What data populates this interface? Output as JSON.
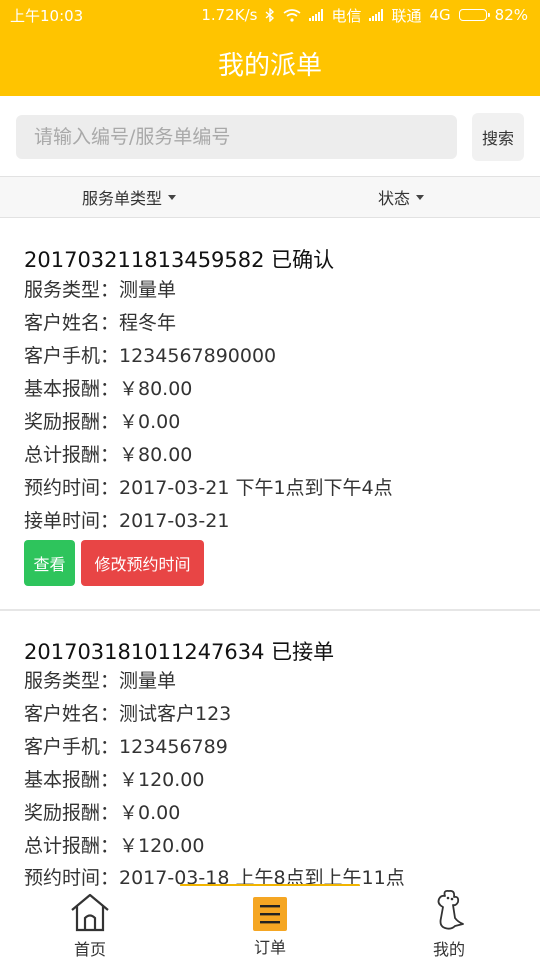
{
  "status_bar": {
    "time": "上午10:03",
    "speed": "1.72K/s",
    "carrier1": "电信",
    "carrier2": "联通",
    "network": "4G",
    "battery": "82%",
    "battery_level": 0.82,
    "icons": [
      "bluetooth-icon",
      "wifi-icon",
      "signal-icon",
      "battery-icon"
    ]
  },
  "header": {
    "title": "我的派单"
  },
  "search": {
    "placeholder": "请输入编号/服务单编号",
    "button_label": "搜索"
  },
  "filters": {
    "type_label": "服务单类型",
    "status_label": "状态"
  },
  "orders": [
    {
      "title": "201703211813459582 已确认",
      "service_type": "服务类型：测量单",
      "customer_name": "客户姓名：程冬年",
      "customer_phone": "客户手机：1234567890000",
      "base_pay": "基本报酬：￥80.00",
      "bonus_pay": "奖励报酬：￥0.00",
      "total_pay": "总计报酬：￥80.00",
      "appointment": "预约时间：2017-03-21 下午1点到下午4点",
      "accept_time": "接单时间：2017-03-21",
      "view_button": "查看",
      "modify_button": "修改预约时间"
    },
    {
      "title": "201703181011247634 已接单",
      "service_type": "服务类型：测量单",
      "customer_name": "客户姓名：测试客户123",
      "customer_phone": "客户手机：123456789",
      "base_pay": "基本报酬：￥120.00",
      "bonus_pay": "奖励报酬：￥0.00",
      "total_pay": "总计报酬：￥120.00",
      "appointment": "预约时间：2017-03-18 上午8点到上午11点"
    }
  ],
  "tab_bar": {
    "tabs": [
      {
        "label": "首页",
        "icon": "home-icon"
      },
      {
        "label": "订单",
        "icon": "orders-icon"
      },
      {
        "label": "我的",
        "icon": "profile-icon"
      }
    ],
    "active_index": 1
  },
  "colors": {
    "brand": "#ffc400",
    "green": "#2ec45c",
    "red": "#e84545",
    "active_tab": "#f5a623"
  }
}
